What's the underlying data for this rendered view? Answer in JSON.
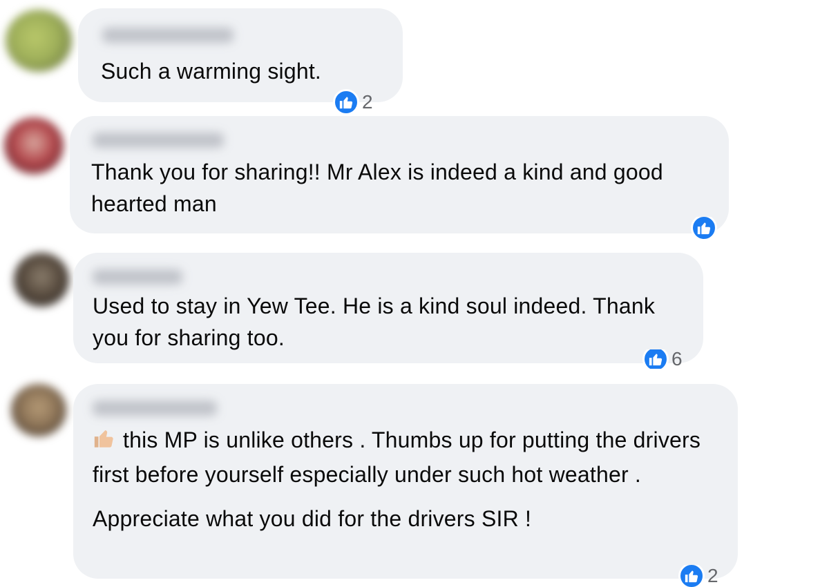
{
  "colors": {
    "bubble": "#eff1f4",
    "like_blue": "#1b7cf2",
    "count_grey": "#65676b"
  },
  "comments": [
    {
      "author_blurred": true,
      "avatar_icon": "avatar-blurred",
      "text": [
        "Such a warming sight."
      ],
      "reaction_icon": "like-icon",
      "reaction_count": "2"
    },
    {
      "author_blurred": true,
      "avatar_icon": "avatar-blurred",
      "text": [
        "Thank you for sharing!! Mr Alex is indeed a kind and good hearted man"
      ],
      "reaction_icon": "like-icon",
      "reaction_count": ""
    },
    {
      "author_blurred": true,
      "avatar_icon": "avatar-blurred",
      "text": [
        "Used to stay in Yew Tee. He is a kind soul indeed. Thank you for sharing too."
      ],
      "reaction_icon": "like-icon",
      "reaction_count": "6"
    },
    {
      "author_blurred": true,
      "avatar_icon": "avatar-blurred",
      "emoji_icon": "thumbs-up-emoji-icon",
      "text": [
        "this MP is unlike others . Thumbs up for putting the drivers first before yourself especially under such hot weather .",
        "Appreciate what you did for the drivers SIR !"
      ],
      "reaction_icon": "like-icon",
      "reaction_count": "2"
    }
  ]
}
